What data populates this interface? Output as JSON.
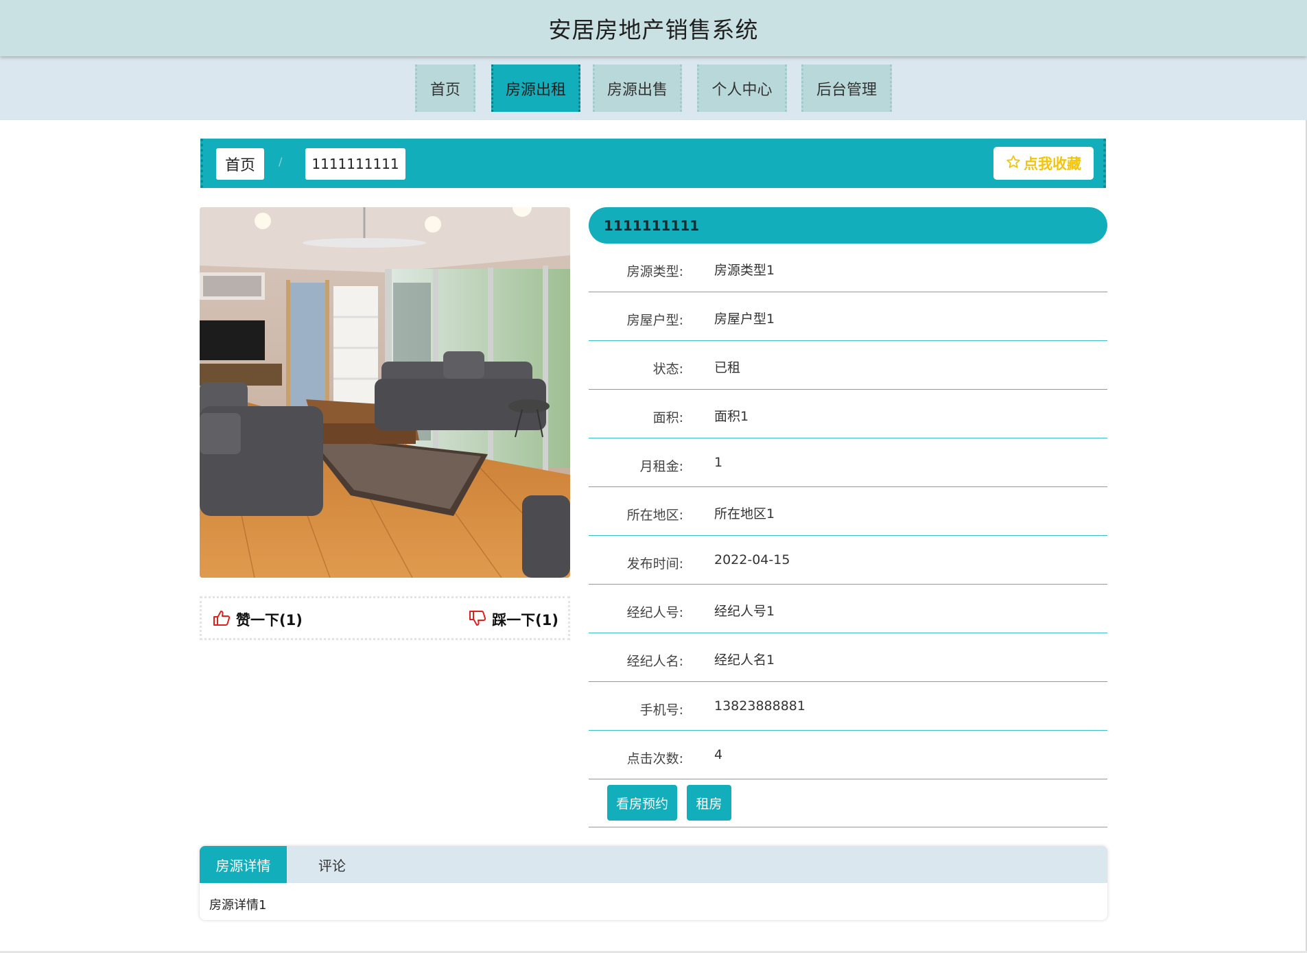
{
  "header": {
    "title": "安居房地产销售系统"
  },
  "nav": {
    "items": [
      {
        "label": "首页"
      },
      {
        "label": "房源出租"
      },
      {
        "label": "房源出售"
      },
      {
        "label": "个人中心"
      },
      {
        "label": "后台管理"
      }
    ],
    "active_index": 1
  },
  "breadcrumb": {
    "home": "首页",
    "separator": "/",
    "current": "1111111111"
  },
  "favorite": {
    "icon": "star-outline-icon",
    "label": "点我收藏"
  },
  "photo": {
    "alt_icon": "living-room-photo"
  },
  "likes": {
    "like_label": "赞一下(1)",
    "dislike_label": "踩一下(1)"
  },
  "detail": {
    "title": "1111111111",
    "rows": [
      {
        "label": "房源类型:",
        "value": "房源类型1"
      },
      {
        "label": "房屋户型:",
        "value": "房屋户型1"
      },
      {
        "label": "状态:",
        "value": "已租"
      },
      {
        "label": "面积:",
        "value": "面积1"
      },
      {
        "label": "月租金:",
        "value": "1"
      },
      {
        "label": "所在地区:",
        "value": "所在地区1"
      },
      {
        "label": "发布时间:",
        "value": "2022-04-15"
      },
      {
        "label": "经纪人号:",
        "value": "经纪人号1"
      },
      {
        "label": "经纪人名:",
        "value": "经纪人名1"
      },
      {
        "label": "手机号:",
        "value": "13823888881"
      },
      {
        "label": "点击次数:",
        "value": "4"
      }
    ],
    "actions": {
      "book_label": "看房预约",
      "rent_label": "租房"
    }
  },
  "tabs": {
    "items": [
      {
        "label": "房源详情"
      },
      {
        "label": "评论"
      }
    ],
    "active_index": 0,
    "content": "房源详情1"
  },
  "colors": {
    "accent": "#12aebb",
    "header_bg": "#c9e1e3",
    "nav_bg": "#dbe7ef",
    "nav_item_bg": "#b9d8d9",
    "favorite_text": "#f2c40d",
    "like_icon": "#e0201a"
  }
}
